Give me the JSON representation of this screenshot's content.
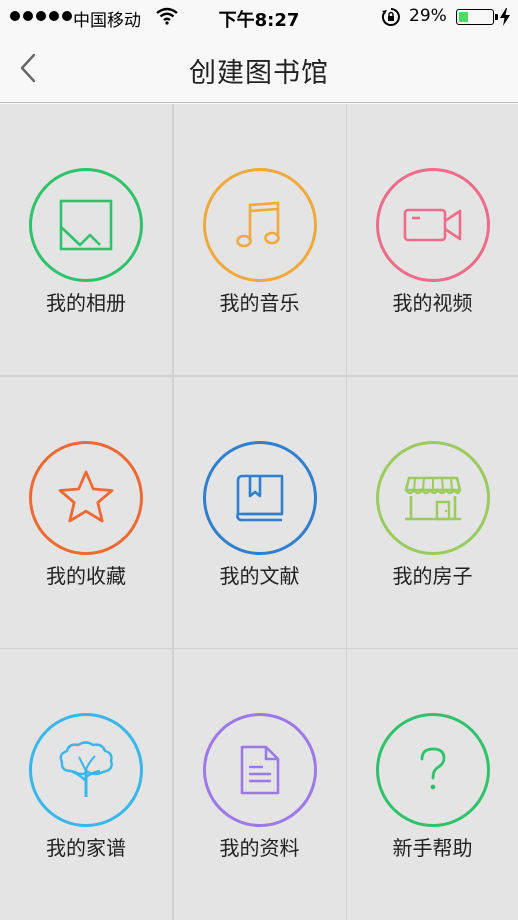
{
  "status_bar": {
    "carrier": "中国移动",
    "time": "下午8:27",
    "battery_percent": "29%",
    "battery_level": 0.29,
    "battery_fill_color": "#4cd964"
  },
  "nav": {
    "title": "创建图书馆",
    "back_icon": "chevron-left-icon"
  },
  "items": [
    {
      "label": "我的相册",
      "icon": "photo-icon",
      "color": "#2ec36b"
    },
    {
      "label": "我的音乐",
      "icon": "music-note-icon",
      "color": "#f0a93d"
    },
    {
      "label": "我的视频",
      "icon": "video-camera-icon",
      "color": "#ee6b8a"
    },
    {
      "label": "我的收藏",
      "icon": "star-icon",
      "color": "#ee6a33"
    },
    {
      "label": "我的文献",
      "icon": "book-icon",
      "color": "#2f7fcf"
    },
    {
      "label": "我的房子",
      "icon": "storefront-icon",
      "color": "#9acb5c"
    },
    {
      "label": "我的家谱",
      "icon": "tree-icon",
      "color": "#39b6ea"
    },
    {
      "label": "我的资料",
      "icon": "document-icon",
      "color": "#9b79e8"
    },
    {
      "label": "新手帮助",
      "icon": "question-mark-icon",
      "color": "#2ec36b"
    }
  ]
}
